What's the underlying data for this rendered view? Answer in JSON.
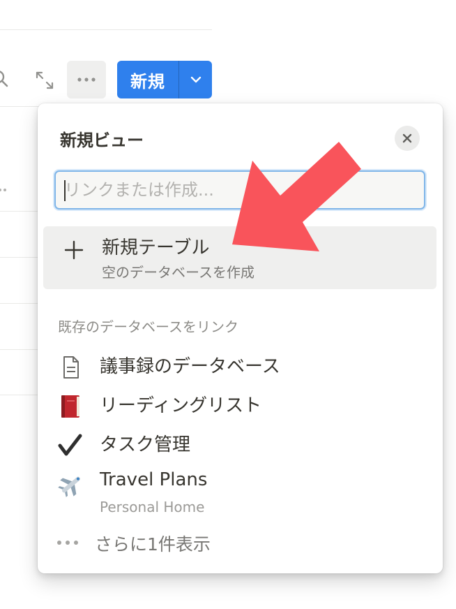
{
  "toolbar": {
    "new_button_label": "新規",
    "colors": {
      "primary": "#2f80ed",
      "more_bg": "#efefee"
    },
    "icons": [
      "search-icon",
      "expand-icon",
      "more-icon",
      "chevron-down-icon"
    ]
  },
  "popup": {
    "title": "新規ビュー",
    "search_placeholder": "リンクまたは作成...",
    "new_table": {
      "label": "新規テーブル",
      "sublabel": "空のデータベースを作成",
      "icon": "plus-icon"
    },
    "section_label": "既存のデータベースをリンク",
    "databases": [
      {
        "label": "議事録のデータベース",
        "icon": "page-icon"
      },
      {
        "label": "リーディングリスト",
        "icon": "red-book-icon"
      },
      {
        "label": "タスク管理",
        "icon": "check-mark-icon"
      },
      {
        "label": "Travel Plans",
        "sublabel": "Personal Home",
        "icon": "airplane-icon"
      }
    ],
    "show_more_label": "さらに1件表示"
  },
  "annotation": {
    "color": "#f9545b",
    "icon": "arrow-icon"
  }
}
